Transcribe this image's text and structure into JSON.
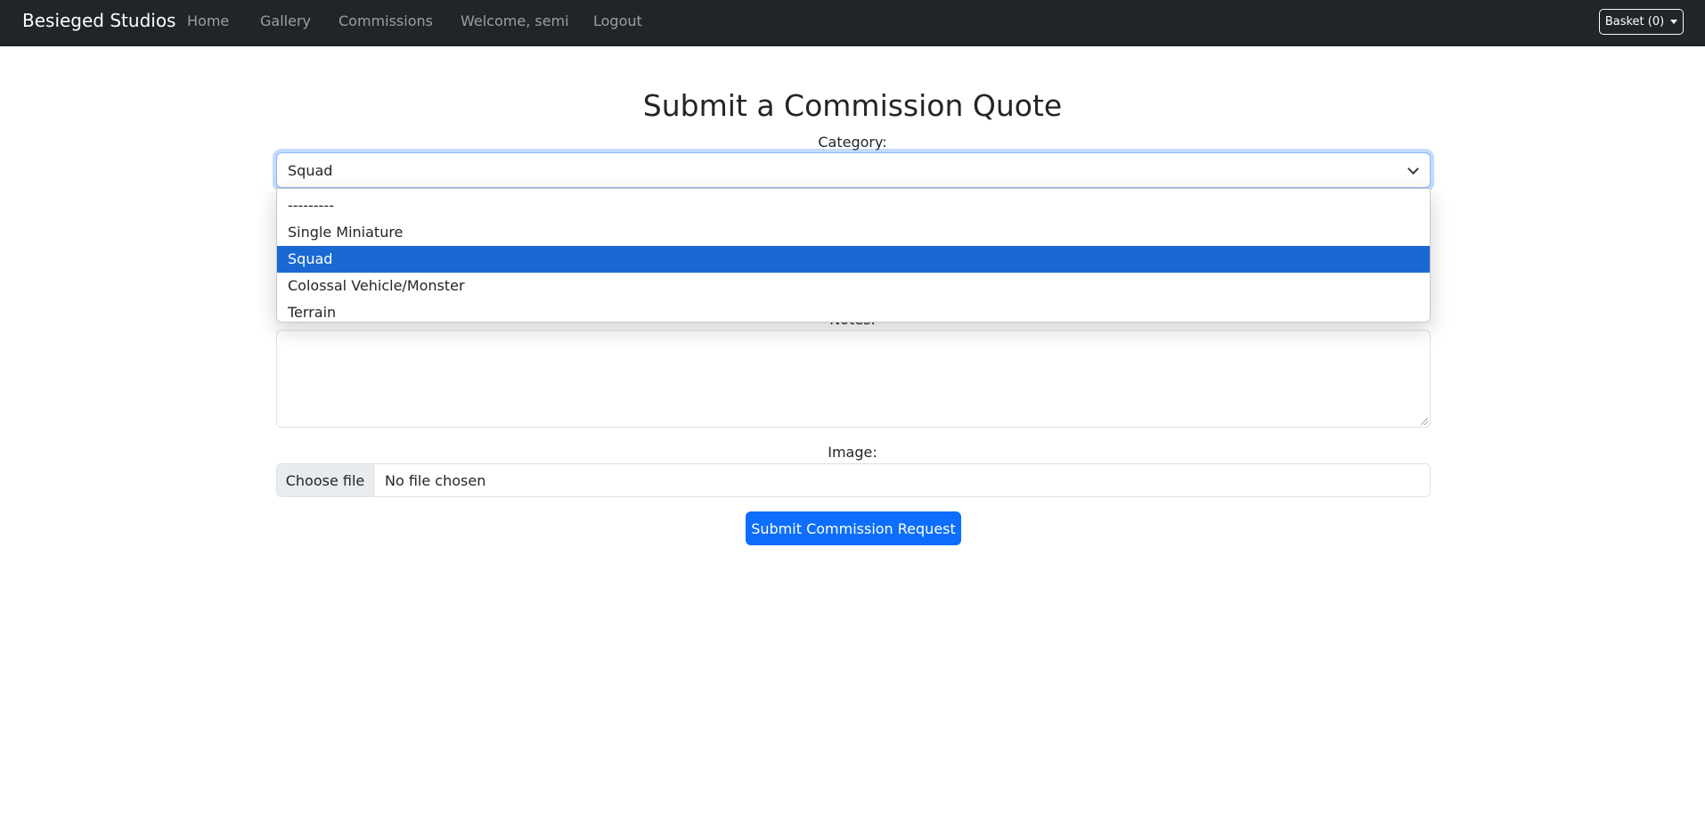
{
  "navbar": {
    "brand": "Besieged Studios",
    "links": [
      "Home",
      "Gallery",
      "Commissions",
      "Welcome, semi",
      "Logout"
    ],
    "basket_label": "Basket (0)"
  },
  "page": {
    "title": "Submit a Commission Quote"
  },
  "form": {
    "category_label": "Category:",
    "category_value": "Squad",
    "category_options": [
      "---------",
      "Single Miniature",
      "Squad",
      "Colossal Vehicle/Monster",
      "Terrain"
    ],
    "selected_option_index": 2,
    "notes_label": "Notes:",
    "notes_value": "",
    "image_label": "Image:",
    "file_button_label": "Choose file",
    "file_status": "No file chosen",
    "submit_label": "Submit Commission Request"
  },
  "colors": {
    "navbar_bg": "#212529",
    "primary": "#0d6efd",
    "option_highlight": "#1a69d2"
  }
}
